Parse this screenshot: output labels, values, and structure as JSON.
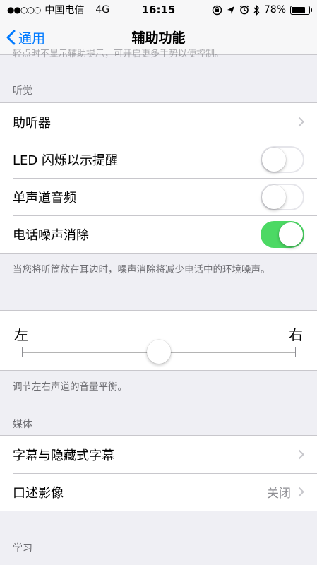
{
  "status_bar": {
    "signal": "●●○○○",
    "carrier": "中国电信",
    "network": "4G",
    "time": "16:15",
    "battery_text": "78%",
    "battery_level": 0.78,
    "icons": [
      "orientation-lock-icon",
      "location-icon",
      "alarm-icon",
      "bluetooth-icon"
    ]
  },
  "nav": {
    "back_label": "通用",
    "title": "辅助功能"
  },
  "cut_text": "轻点时不显示辅助提示，可开启更多手势以便控制。",
  "hearing": {
    "header": "听觉",
    "rows": [
      {
        "label": "助听器",
        "type": "chevron"
      },
      {
        "label": "LED 闪烁以示提醒",
        "type": "toggle",
        "on": false
      },
      {
        "label": "单声道音频",
        "type": "toggle",
        "on": false
      },
      {
        "label": "电话噪声消除",
        "type": "toggle",
        "on": true
      }
    ],
    "footer": "当您将听筒放在耳边时，噪声消除将减少电话中的环境噪声。"
  },
  "balance": {
    "left_label": "左",
    "right_label": "右",
    "value": 0.5,
    "footer": "调节左右声道的音量平衡。"
  },
  "media": {
    "header": "媒体",
    "rows": [
      {
        "label": "字幕与隐藏式字幕",
        "value": ""
      },
      {
        "label": "口述影像",
        "value": "关闭"
      }
    ]
  },
  "learning": {
    "header": "学习"
  },
  "colors": {
    "accent": "#007aff",
    "toggle_on": "#4cd964",
    "background": "#efeff4",
    "secondary_text": "#6d6d72"
  }
}
